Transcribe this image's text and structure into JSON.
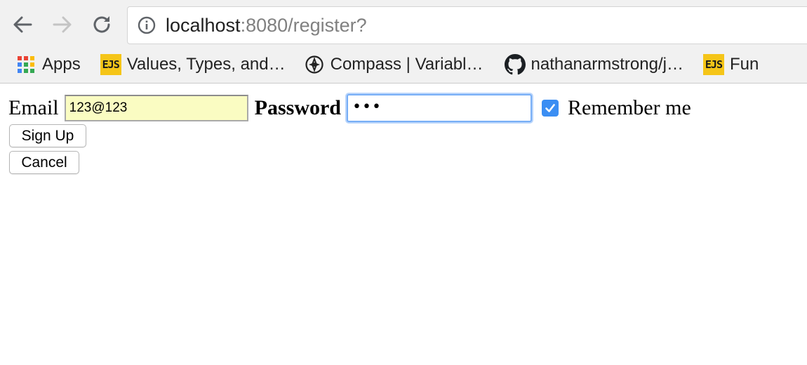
{
  "browser": {
    "url_host": "localhost",
    "url_rest": ":8080/register?",
    "icons": {
      "back": "arrow-left-icon",
      "forward": "arrow-right-icon",
      "reload": "reload-icon",
      "info": "info-icon"
    }
  },
  "bookmarks": [
    {
      "label": "Apps",
      "icon": "apps-grid-icon"
    },
    {
      "label": "Values, Types, and…",
      "icon": "ejs-icon",
      "badge": "EJS"
    },
    {
      "label": "Compass | Variabl…",
      "icon": "compass-icon"
    },
    {
      "label": "nathanarmstrong/j…",
      "icon": "github-icon"
    },
    {
      "label": "Fun",
      "icon": "ejs-icon",
      "badge": "EJS"
    }
  ],
  "form": {
    "email_label": "Email",
    "email_value": "123@123",
    "password_label": "Password",
    "password_value": "•••",
    "remember_label": "Remember me",
    "remember_checked": true,
    "signup_label": "Sign Up",
    "cancel_label": "Cancel"
  },
  "colors": {
    "autofill_bg": "#fafcc2",
    "focus_ring": "#77aef6",
    "checkbox": "#3b8ef3",
    "ejs_badge": "#f5c518"
  }
}
